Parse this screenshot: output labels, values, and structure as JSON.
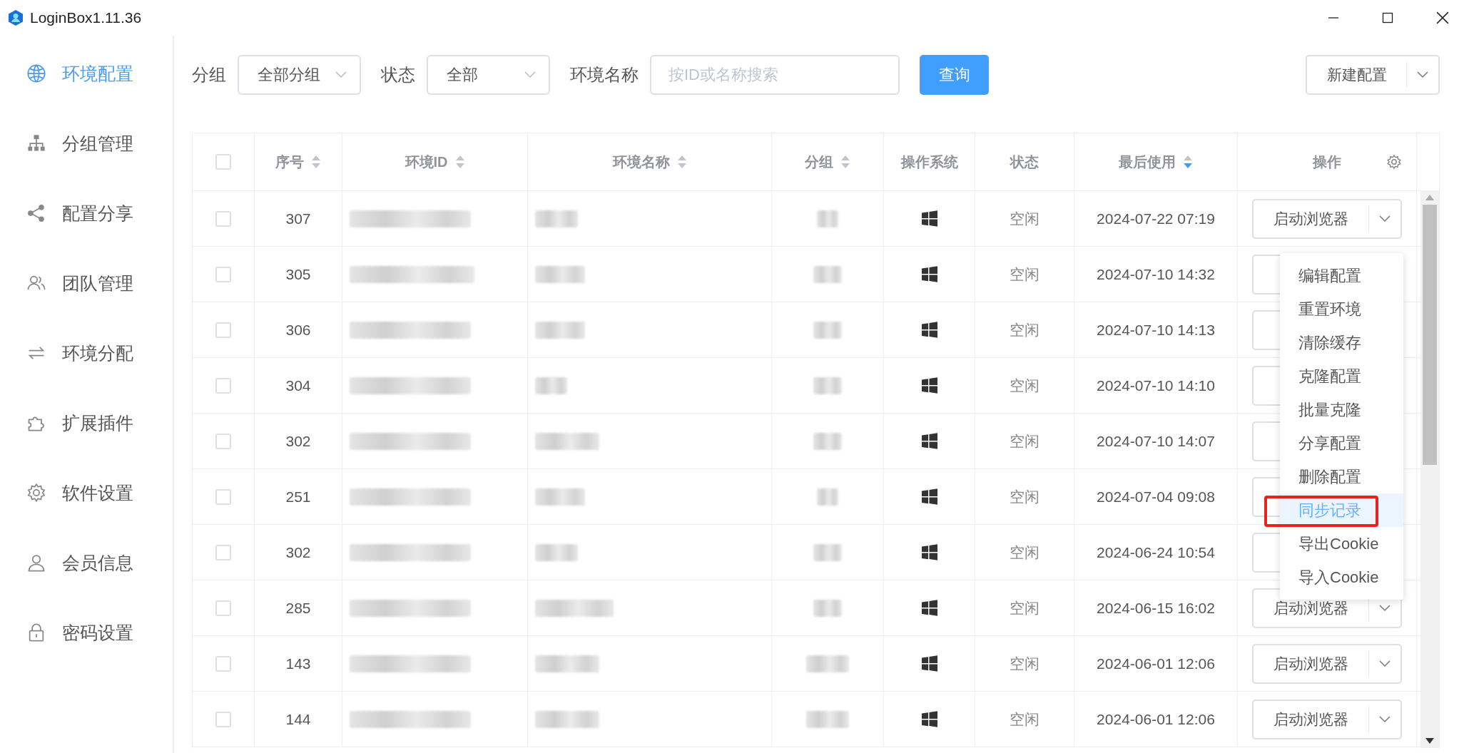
{
  "window": {
    "title": "LoginBox1.11.36"
  },
  "sidebar": {
    "items": [
      {
        "label": "环境配置",
        "kind": "globe",
        "selected": true
      },
      {
        "label": "分组管理",
        "kind": "hierarchy",
        "selected": false
      },
      {
        "label": "配置分享",
        "kind": "share",
        "selected": false
      },
      {
        "label": "团队管理",
        "kind": "team",
        "selected": false
      },
      {
        "label": "环境分配",
        "kind": "arrows",
        "selected": false
      },
      {
        "label": "扩展插件",
        "kind": "puzzle",
        "selected": false
      },
      {
        "label": "软件设置",
        "kind": "gear",
        "selected": false
      },
      {
        "label": "会员信息",
        "kind": "user",
        "selected": false
      },
      {
        "label": "密码设置",
        "kind": "lock",
        "selected": false
      }
    ]
  },
  "filters": {
    "group_label": "分组",
    "group_value": "全部分组",
    "status_label": "状态",
    "status_value": "全部",
    "name_label": "环境名称",
    "search_placeholder": "按ID或名称搜索",
    "query_button": "查询",
    "new_button": "新建配置"
  },
  "table": {
    "select_all_checked": false,
    "columns": [
      {
        "label": "序号",
        "sortable": true,
        "sorted": false,
        "settings": false
      },
      {
        "label": "环境ID",
        "sortable": true,
        "sorted": false,
        "settings": false
      },
      {
        "label": "环境名称",
        "sortable": true,
        "sorted": false,
        "settings": false
      },
      {
        "label": "分组",
        "sortable": true,
        "sorted": false,
        "settings": false
      },
      {
        "label": "操作系统",
        "sortable": false,
        "settings": false
      },
      {
        "label": "状态",
        "sortable": false,
        "settings": false
      },
      {
        "label": "最后使用",
        "sortable": true,
        "sorted": true,
        "settings": false
      },
      {
        "label": "操作",
        "sortable": false,
        "settings": true
      }
    ],
    "rows": [
      {
        "checked": false,
        "seq": "307",
        "kind": "windows",
        "status": "空闲",
        "last_used": "2024-07-22 07:19",
        "action": "启动浏览器"
      },
      {
        "checked": false,
        "seq": "305",
        "kind": "windows",
        "status": "空闲",
        "last_used": "2024-07-10 14:32"
      },
      {
        "checked": false,
        "seq": "306",
        "kind": "windows",
        "status": "空闲",
        "last_used": "2024-07-10 14:13"
      },
      {
        "checked": false,
        "seq": "304",
        "kind": "windows",
        "status": "空闲",
        "last_used": "2024-07-10 14:10"
      },
      {
        "checked": false,
        "seq": "302",
        "kind": "windows",
        "status": "空闲",
        "last_used": "2024-07-10 14:07"
      },
      {
        "checked": false,
        "seq": "251",
        "kind": "windows",
        "status": "空闲",
        "last_used": "2024-07-04 09:08"
      },
      {
        "checked": false,
        "seq": "302",
        "kind": "windows",
        "status": "空闲",
        "last_used": "2024-06-24 10:54"
      },
      {
        "checked": false,
        "seq": "285",
        "kind": "windows",
        "status": "空闲",
        "last_used": "2024-06-15 16:02",
        "action": "启动浏览器"
      },
      {
        "checked": false,
        "seq": "143",
        "kind": "windows",
        "status": "空闲",
        "last_used": "2024-06-01 12:06",
        "action": "启动浏览器"
      },
      {
        "checked": false,
        "seq": "144",
        "kind": "windows",
        "status": "空闲",
        "last_used": "2024-06-01 12:06",
        "action": "启动浏览器"
      }
    ]
  },
  "action_menu": {
    "items": [
      {
        "label": "编辑配置",
        "selected": false
      },
      {
        "label": "重置环境",
        "selected": false
      },
      {
        "label": "清除缓存",
        "selected": false
      },
      {
        "label": "克隆配置",
        "selected": false
      },
      {
        "label": "批量克隆",
        "selected": false
      },
      {
        "label": "分享配置",
        "selected": false
      },
      {
        "label": "删除配置",
        "selected": false
      },
      {
        "label": "同步记录",
        "selected": true
      },
      {
        "label": "导出Cookie",
        "selected": false
      },
      {
        "label": "导入Cookie",
        "selected": false
      }
    ]
  }
}
